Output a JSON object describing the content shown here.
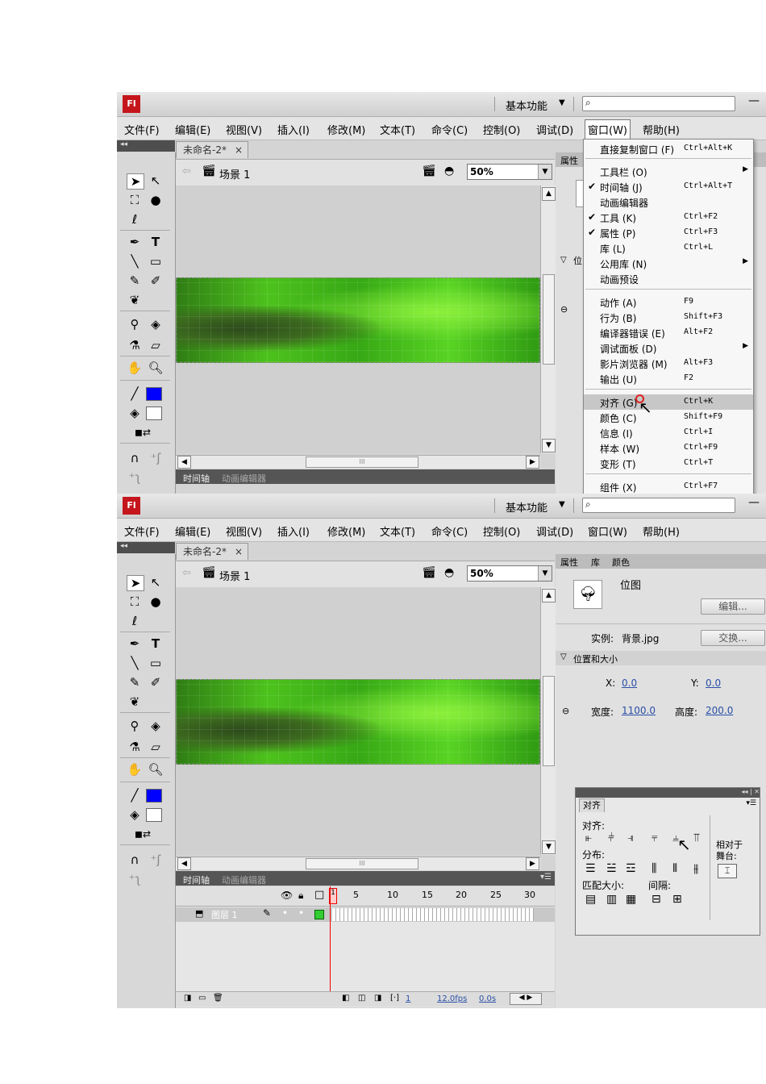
{
  "app": {
    "logo": "Fl",
    "workspace": "基本功能",
    "workspace_arrow": "▼",
    "search_icon": "⌕",
    "minimize": "—"
  },
  "menubar": [
    "文件(F)",
    "编辑(E)",
    "视图(V)",
    "插入(I)",
    "修改(M)",
    "文本(T)",
    "命令(C)",
    "控制(O)",
    "调试(D)",
    "窗口(W)",
    "帮助(H)"
  ],
  "document": {
    "tab_title": "未命名-2*",
    "tab_close": "×",
    "scene": "场景 1",
    "zoom": "50%"
  },
  "timeline": {
    "tab_timeline": "时间轴",
    "tab_motion_editor": "动画编辑器",
    "ruler": [
      "5",
      "10",
      "15",
      "20",
      "25",
      "30"
    ],
    "first_frame": "1",
    "layer_name": "图层 1",
    "footer_frame": "1",
    "footer_fps": "12.0fps",
    "footer_time": "0.0s"
  },
  "properties": {
    "tabs": [
      "属性",
      "库",
      "颜色"
    ],
    "type": "位图",
    "edit_btn": "编辑...",
    "instance_label": "实例:",
    "instance_value": "背景.jpg",
    "swap_btn": "交换...",
    "section_pos_size": "位置和大小",
    "x_label": "X:",
    "x_value": "0.0",
    "y_label": "Y:",
    "y_value": "0.0",
    "w_label": "宽度:",
    "w_value": "1100.0",
    "h_label": "高度:",
    "h_value": "200.0",
    "partial_tab": "属性",
    "partial_section": "位"
  },
  "window_menu": [
    {
      "label": "直接复制窗口 (F)",
      "shortcut": "Ctrl+Alt+K"
    },
    {
      "label": "工具栏 (O)",
      "shortcut": "",
      "submenu": true
    },
    {
      "label": "时间轴 (J)",
      "shortcut": "Ctrl+Alt+T",
      "checked": true
    },
    {
      "label": "动画编辑器",
      "shortcut": ""
    },
    {
      "label": "工具 (K)",
      "shortcut": "Ctrl+F2",
      "checked": true
    },
    {
      "label": "属性 (P)",
      "shortcut": "Ctrl+F3",
      "checked": true
    },
    {
      "label": "库 (L)",
      "shortcut": "Ctrl+L"
    },
    {
      "label": "公用库 (N)",
      "shortcut": "",
      "submenu": true
    },
    {
      "label": "动画预设",
      "shortcut": ""
    },
    {
      "label": "动作 (A)",
      "shortcut": "F9"
    },
    {
      "label": "行为 (B)",
      "shortcut": "Shift+F3"
    },
    {
      "label": "编译器错误 (E)",
      "shortcut": "Alt+F2"
    },
    {
      "label": "调试面板 (D)",
      "shortcut": "",
      "submenu": true
    },
    {
      "label": "影片浏览器 (M)",
      "shortcut": "Alt+F3"
    },
    {
      "label": "输出 (U)",
      "shortcut": "F2"
    },
    {
      "label": "对齐 (G)",
      "shortcut": "Ctrl+K",
      "highlighted": true
    },
    {
      "label": "颜色 (C)",
      "shortcut": "Shift+F9"
    },
    {
      "label": "信息 (I)",
      "shortcut": "Ctrl+I"
    },
    {
      "label": "样本 (W)",
      "shortcut": "Ctrl+F9"
    },
    {
      "label": "变形 (T)",
      "shortcut": "Ctrl+T"
    },
    {
      "label": "组件 (X)",
      "shortcut": "Ctrl+F7"
    }
  ],
  "align_panel": {
    "tab": "对齐",
    "align": "对齐:",
    "distribute": "分布:",
    "match_size": "匹配大小:",
    "spacing": "间隔:",
    "relative_to": "相对于",
    "stage": "舞台:"
  },
  "colors": {
    "stroke": "#0000ff",
    "fill": "#ffffff",
    "menu_highlight": "#c7c7c7",
    "playhead": "#ee0000"
  }
}
